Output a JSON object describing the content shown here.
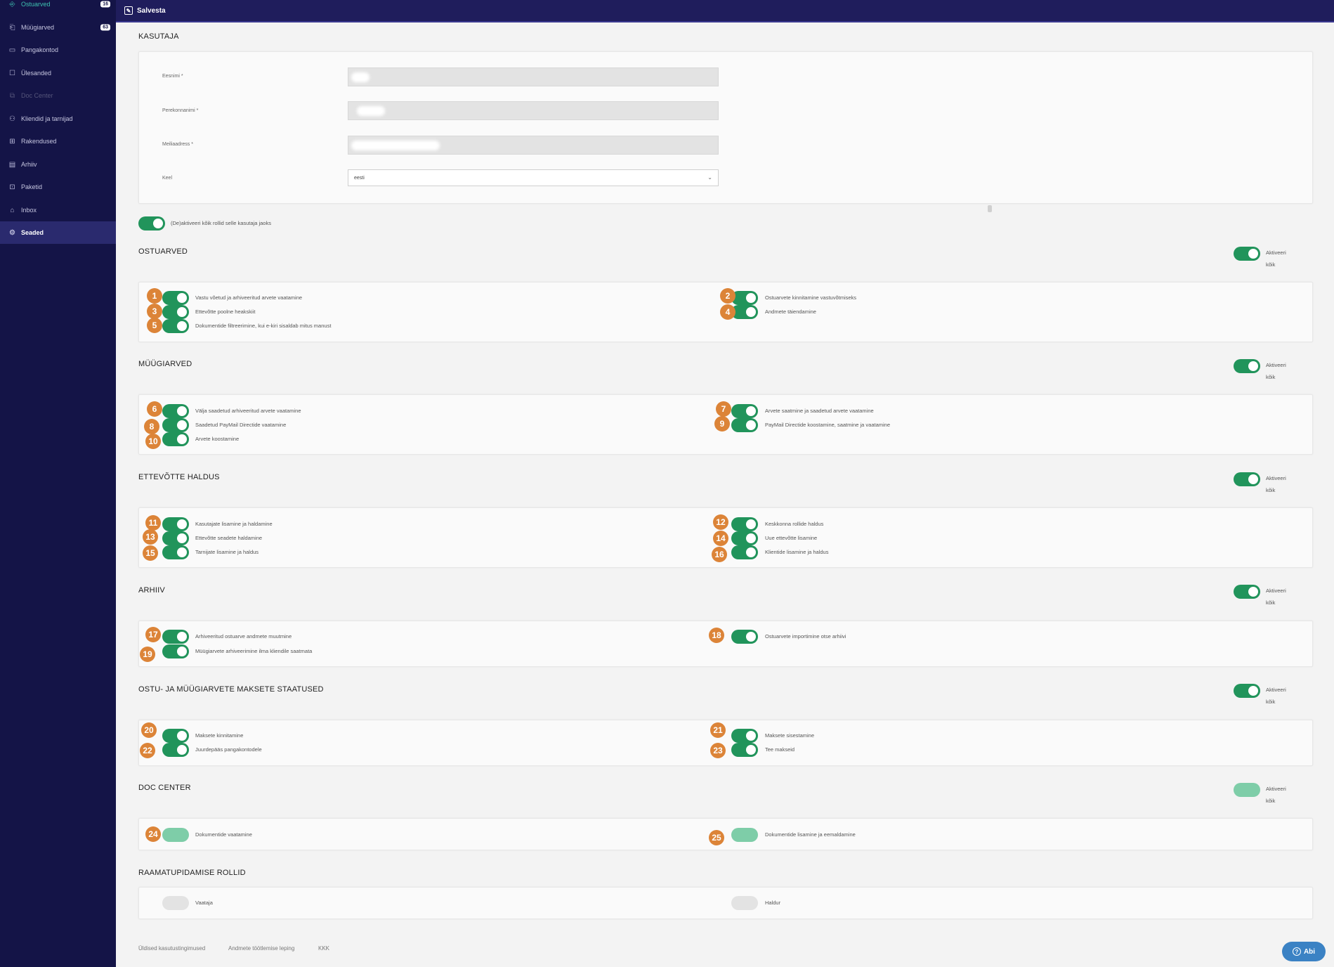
{
  "sidebar": {
    "items": [
      {
        "label": "Ostuarved",
        "icon": "purchase-invoice-icon",
        "badge": "16",
        "state": "teal"
      },
      {
        "label": "Müügiarved",
        "icon": "sales-invoice-icon",
        "badge": "63",
        "state": ""
      },
      {
        "label": "Pangakontod",
        "icon": "bank-account-icon",
        "badge": "",
        "state": ""
      },
      {
        "label": "Ülesanded",
        "icon": "tasks-icon",
        "badge": "",
        "state": ""
      },
      {
        "label": "Doc Center",
        "icon": "doc-center-icon",
        "badge": "",
        "state": "disabled"
      },
      {
        "label": "Kliendid ja tarnijad",
        "icon": "clients-icon",
        "badge": "",
        "state": ""
      },
      {
        "label": "Rakendused",
        "icon": "apps-icon",
        "badge": "",
        "state": ""
      },
      {
        "label": "Arhiiv",
        "icon": "archive-icon",
        "badge": "",
        "state": ""
      },
      {
        "label": "Paketid",
        "icon": "packages-icon",
        "badge": "",
        "state": ""
      },
      {
        "label": "Inbox",
        "icon": "inbox-icon",
        "badge": "",
        "state": ""
      },
      {
        "label": "Seaded",
        "icon": "settings-icon",
        "badge": "",
        "state": "active"
      }
    ]
  },
  "topbar": {
    "save_label": "Salvesta",
    "save_icon": "save-icon"
  },
  "user": {
    "title": "KASUTAJA",
    "first_name_label": "Eesnimi *",
    "last_name_label": "Perekonnanimi *",
    "email_label": "Meiliaadress *",
    "language_label": "Keel",
    "language_value": "eesti"
  },
  "deactivate_all_label": "(De)aktiveeri kõik rollid selle kasutaja jaoks",
  "activate_all_label": "Aktiveeri kõik",
  "sections": {
    "ostuarved": {
      "title": "OSTUARVED",
      "perms": {
        "p1": "Vastu võetud ja arhiveeritud arvete vaatamine",
        "p2": "Ostuarvete kinnitamine vastuvõtmiseks",
        "p3": "Ettevõtte poolne heakskiit",
        "p4": "Andmete täiendamine",
        "p5": "Dokumentide filtreerimine, kui e-kiri sisaldab mitus manust"
      }
    },
    "myygiarved": {
      "title": "MÜÜGIARVED",
      "perms": {
        "p6": "Välja saadetud arhiveeritud arvete vaatamine",
        "p7": "Arvete saatmine ja saadetud arvete vaatamine",
        "p8": "Saadetud PayMail Directide vaatamine",
        "p9": "PayMail Directide koostamine, saatmine ja vaatamine",
        "p10": "Arvete koostamine"
      }
    },
    "ettevotte": {
      "title": "ETTEVÕTTE HALDUS",
      "perms": {
        "p11": "Kasutajate lisamine ja haldamine",
        "p12": "Keskkonna rollide haldus",
        "p13": "Ettevõtte seadete haldamine",
        "p14": "Uue ettevõtte lisamine",
        "p15": "Tarnijate lisamine ja haldus",
        "p16": "Klientide lisamine ja haldus"
      }
    },
    "arhiiv": {
      "title": "ARHIIV",
      "perms": {
        "p17": "Arhiveeritud ostuarve andmete muutmine",
        "p18": "Ostuarvete importimine otse arhiivi",
        "p19": "Müügiarvete arhiveerimine ilma kliendile saatmata"
      }
    },
    "maksete": {
      "title": "OSTU- JA MÜÜGIARVETE MAKSETE STAATUSED",
      "perms": {
        "p20": "Maksete kinnitamine",
        "p21": "Maksete sisestamine",
        "p22": "Juurdepääs pangakontodele",
        "p23": "Tee makseid"
      }
    },
    "doccenter": {
      "title": "DOC CENTER",
      "perms": {
        "p24": "Dokumentide vaatamine",
        "p25": "Dokumentide lisamine ja eemaldamine"
      }
    },
    "raamatupidamise": {
      "title": "RAAMATUPIDAMISE ROLLID",
      "perms": {
        "vaataja": "Vaataja",
        "haldur": "Haldur"
      }
    }
  },
  "badges": [
    "1",
    "2",
    "3",
    "4",
    "5",
    "6",
    "7",
    "8",
    "9",
    "10",
    "11",
    "12",
    "13",
    "14",
    "15",
    "16",
    "17",
    "18",
    "19",
    "20",
    "21",
    "22",
    "23",
    "24",
    "25"
  ],
  "footer": {
    "terms": "Üldised kasutustingimused",
    "dpa": "Andmete töötlemise leping",
    "faq": "KKK"
  },
  "help": {
    "label": "Abi",
    "icon": "help-icon"
  },
  "colors": {
    "sidebar": "#141447",
    "topbar": "#1f1d5c",
    "toggle_on": "#21945b",
    "toggle_disabled": "#7ecda8",
    "badge": "#dc8438",
    "help": "#3b82c4"
  }
}
